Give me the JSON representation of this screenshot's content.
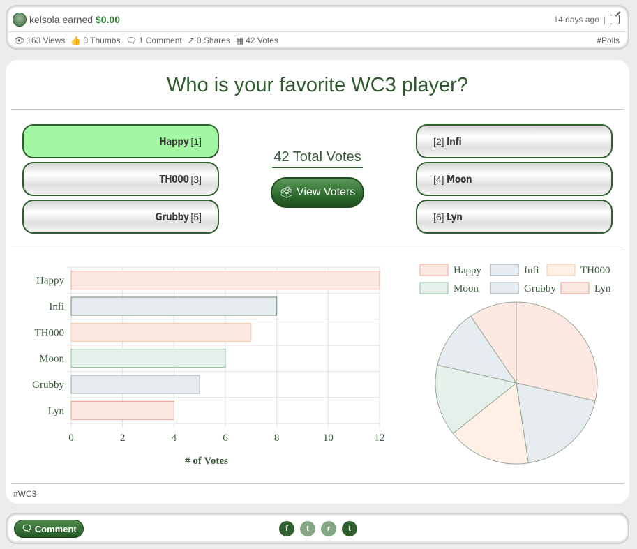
{
  "header": {
    "user": "kelsola",
    "earned_text": "earned",
    "amount": "$0.00",
    "time_ago": "14 days ago",
    "stats": [
      {
        "icon": "eye-icon",
        "glyph": "👁",
        "label": "163 Views"
      },
      {
        "icon": "thumbs-up-icon",
        "glyph": "👍",
        "label": "0 Thumbs"
      },
      {
        "icon": "comment-icon",
        "glyph": "🗨",
        "label": "1 Comment"
      },
      {
        "icon": "share-icon",
        "glyph": "↗",
        "label": "0 Shares"
      },
      {
        "icon": "ballot-icon",
        "glyph": "▦",
        "label": "42 Votes"
      }
    ],
    "category": "#Polls"
  },
  "poll": {
    "title": "Who is your favorite WC3 player?",
    "total_votes": "42 Total Votes",
    "view_voters_label": "View Voters",
    "options_left": [
      {
        "name": "Happy",
        "index": "[1]",
        "selected": true
      },
      {
        "name": "TH000",
        "index": "[3]",
        "selected": false
      },
      {
        "name": "Grubby",
        "index": "[5]",
        "selected": false
      }
    ],
    "options_right": [
      {
        "name": "Infi",
        "index": "[2]"
      },
      {
        "name": "Moon",
        "index": "[4]"
      },
      {
        "name": "Lyn",
        "index": "[6]"
      }
    ],
    "tag": "#WC3"
  },
  "chart_data": [
    {
      "type": "bar",
      "orientation": "horizontal",
      "categories": [
        "Happy",
        "Infi",
        "TH000",
        "Moon",
        "Grubby",
        "Lyn"
      ],
      "values": [
        12,
        8,
        7,
        6,
        5,
        4
      ],
      "xlabel": "# of Votes",
      "xlim": [
        0,
        12
      ],
      "xticks": [
        0,
        2,
        4,
        6,
        8,
        10,
        12
      ],
      "grid": true,
      "fill_colors": [
        "#fde8e2",
        "#e6ecef",
        "#fde8e2",
        "#e6f0ea",
        "#e6ecef",
        "#fde8e2"
      ],
      "stroke_colors": [
        "#f1a99a",
        "#6c8a7a",
        "#f6c8a8",
        "#8fbf9a",
        "#9fa8ab",
        "#e49b8f"
      ]
    },
    {
      "type": "pie",
      "labels": [
        "Happy",
        "Infi",
        "TH000",
        "Moon",
        "Grubby",
        "Lyn"
      ],
      "values": [
        12,
        8,
        7,
        6,
        5,
        4
      ],
      "legend": "top",
      "fill_colors": [
        "#fde8e2",
        "#e6ecef",
        "#fff0e6",
        "#e6f0ea",
        "#e6ecef",
        "#fde8e2"
      ],
      "stroke_colors": [
        "#f1a99a",
        "#9aa6ad",
        "#f6c8a8",
        "#8fbf9a",
        "#9fa8ab",
        "#e49b8f"
      ]
    }
  ],
  "footer": {
    "comment_label": "Comment",
    "social": [
      {
        "icon": "facebook-icon",
        "glyph": "f"
      },
      {
        "icon": "twitter-icon",
        "glyph": "t"
      },
      {
        "icon": "reddit-icon",
        "glyph": "r"
      },
      {
        "icon": "tumblr-icon",
        "glyph": "t"
      }
    ]
  },
  "colors": {
    "accent": "#2f5f2f",
    "selected": "#a3f7a3"
  }
}
